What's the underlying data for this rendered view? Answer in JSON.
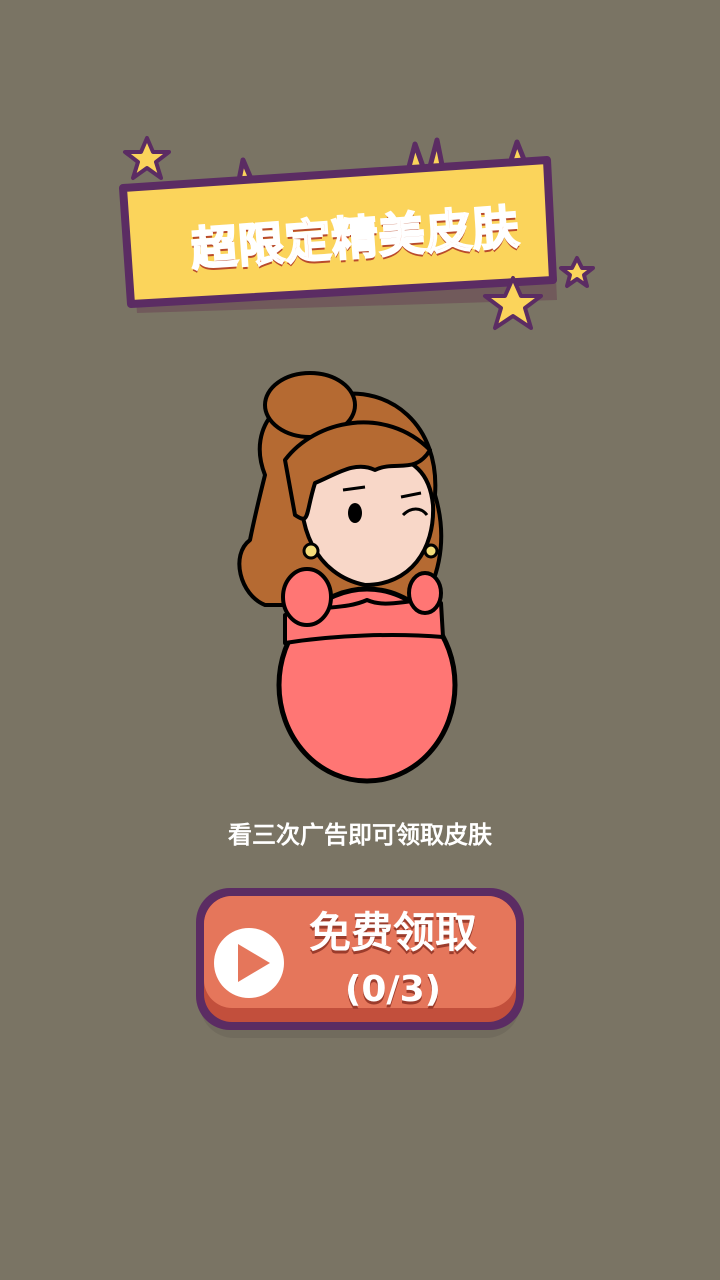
{
  "banner": {
    "title": "超限定精美皮肤"
  },
  "hint": {
    "text": "看三次广告即可领取皮肤"
  },
  "claim_button": {
    "label": "免费领取",
    "progress": "(0/3)",
    "views_done": 0,
    "views_required": 3
  },
  "colors": {
    "background": "#7a7464",
    "banner_yellow": "#fbd45b",
    "banner_outline": "#5b2c63",
    "title_orange": "#f37548",
    "button_orange": "#e5765b",
    "dress_pink": "#ff7674",
    "hair_brown": "#b56a32"
  },
  "icons": {
    "play": "play-icon",
    "star": "star-icon"
  }
}
